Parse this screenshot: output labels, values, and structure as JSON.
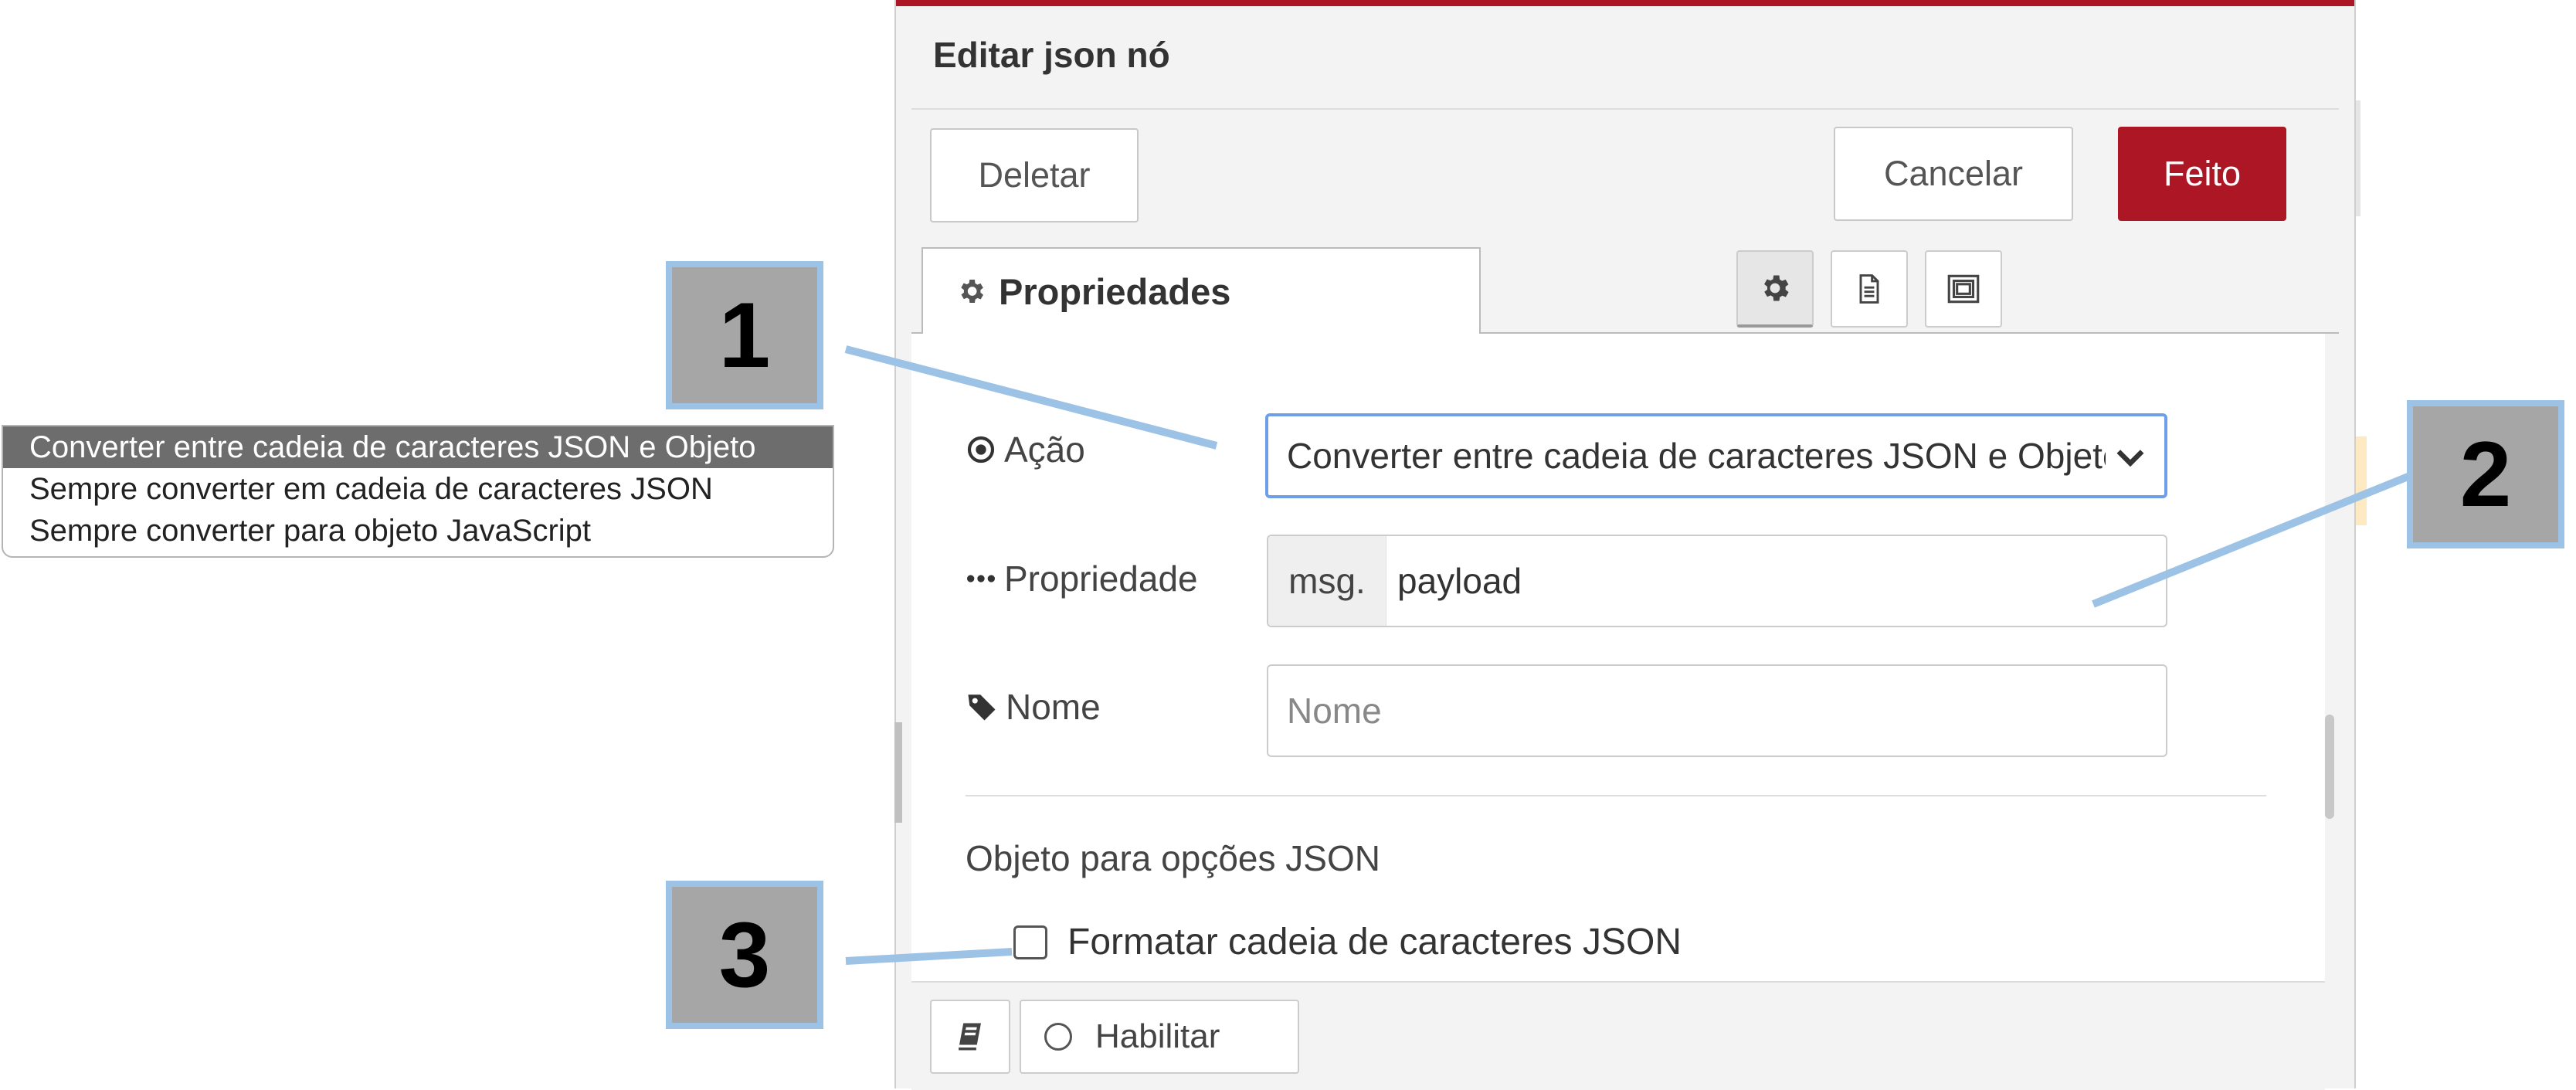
{
  "dropdown_options": [
    "Converter entre cadeia de caracteres JSON e Objeto",
    "Sempre converter em cadeia de caracteres JSON",
    "Sempre converter para objeto JavaScript"
  ],
  "editor": {
    "title": "Editar json nó",
    "buttons": {
      "delete": "Deletar",
      "cancel": "Cancelar",
      "done": "Feito"
    },
    "tab": {
      "label": "Propriedades"
    },
    "tab_icons": [
      "gear-icon",
      "document-icon",
      "frame-icon"
    ],
    "fields": {
      "action": {
        "label": "Ação",
        "value": "Converter entre cadeia de caracteres JSON e Objeto"
      },
      "property": {
        "label": "Propriedade",
        "prefix": "msg.",
        "value": "payload"
      },
      "name": {
        "label": "Nome",
        "placeholder": "Nome"
      }
    },
    "section_title": "Objeto para opções JSON",
    "format_checkbox": {
      "label": "Formatar cadeia de caracteres JSON",
      "checked": false
    },
    "footer": {
      "enable": "Habilitar"
    }
  },
  "callouts": [
    "1",
    "2",
    "3"
  ],
  "colors": {
    "accent": "#ad1625",
    "callout_border": "#9cc2e5",
    "callout_fill": "#a6a6a6",
    "focus": "#6f9ee8"
  }
}
